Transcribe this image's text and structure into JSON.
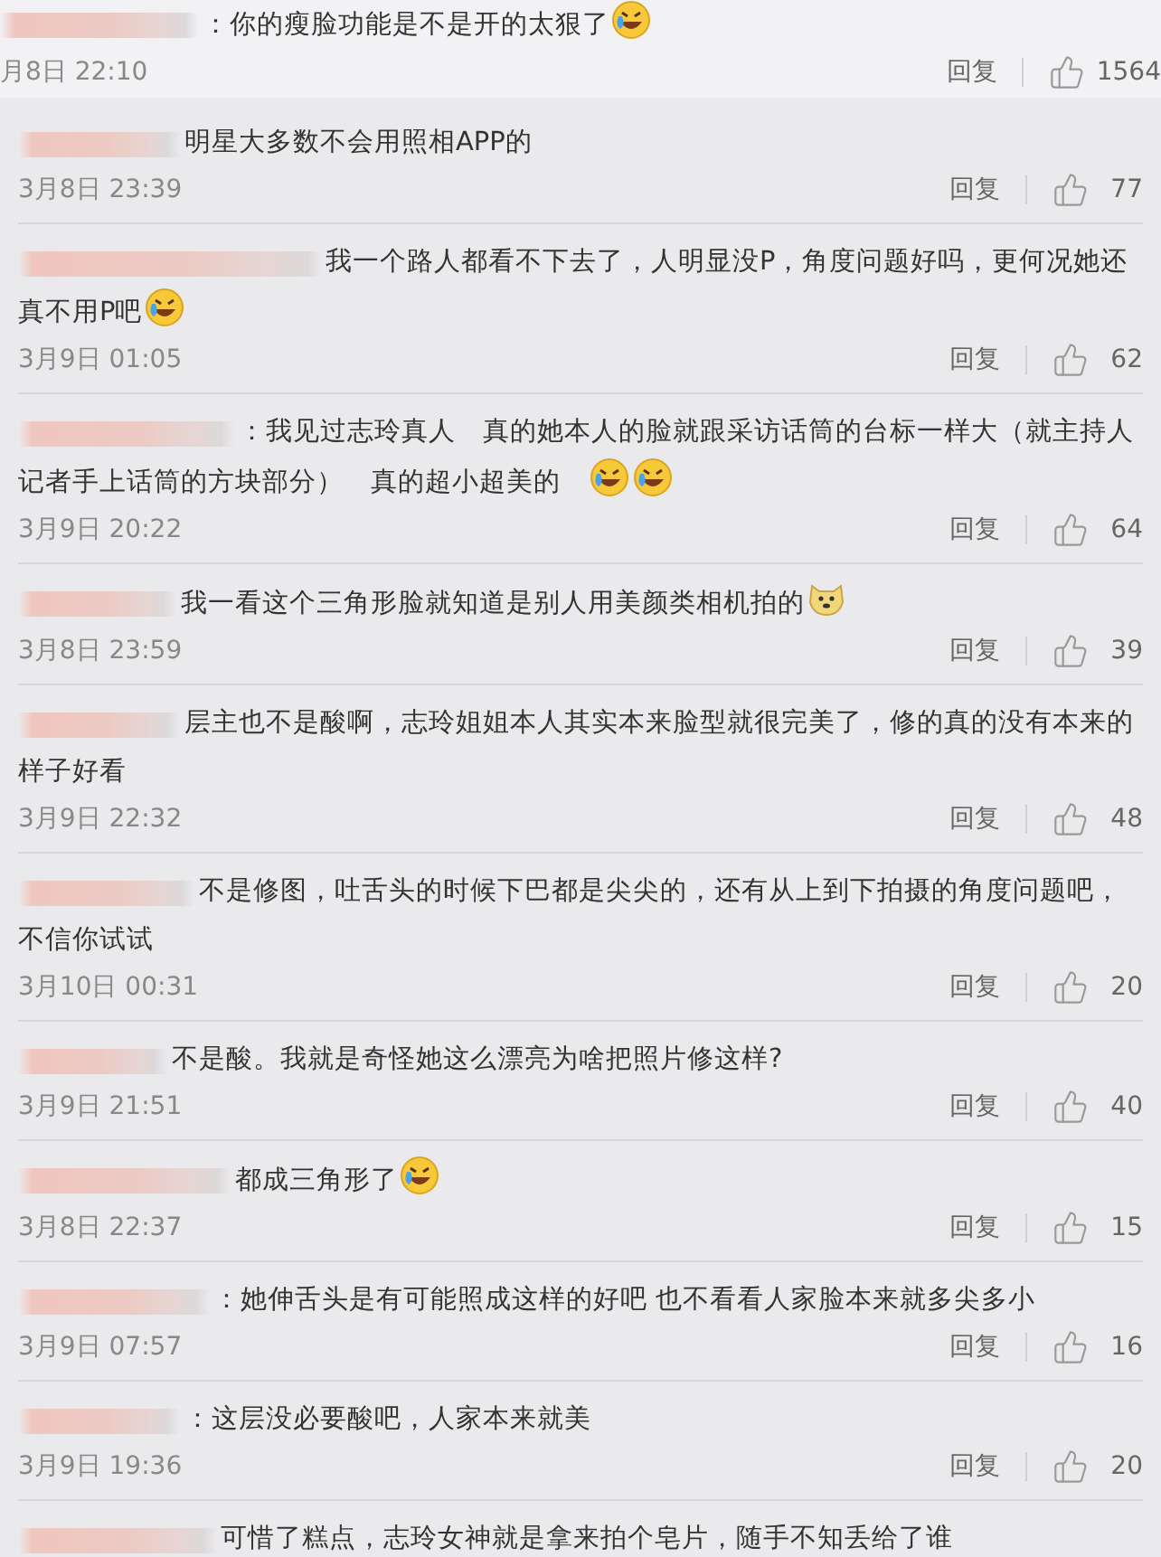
{
  "comments": [
    {
      "kind": "main",
      "text": "：你的瘦脸功能是不是开的太狠了",
      "emojis": [
        {
          "kind": "laugh-cry"
        }
      ],
      "time": "月8日 22:10",
      "reply": "回复",
      "likes": "1564"
    },
    {
      "kind": "sub",
      "text": "明星大多数不会用照相APP的",
      "time": "3月8日 23:39",
      "reply": "回复",
      "likes": "77"
    },
    {
      "kind": "sub",
      "text": "我一个路人都看不下去了，人明显没P，角度问题好吗，更何况她还真不用P吧",
      "emojis": [
        {
          "kind": "laugh-cry"
        }
      ],
      "time": "3月9日 01:05",
      "reply": "回复",
      "likes": "62"
    },
    {
      "kind": "sub",
      "text": "：我见过志玲真人　真的她本人的脸就跟采访话筒的台标一样大（就主持人记者手上话筒的方块部分）　真的超小超美的　",
      "emojis": [
        {
          "kind": "laugh-cry"
        },
        {
          "kind": "laugh-cry"
        }
      ],
      "time": "3月9日 20:22",
      "reply": "回复",
      "likes": "64"
    },
    {
      "kind": "sub",
      "text": "我一看这个三角形脸就知道是别人用美颜类相机拍的",
      "emojis": [
        {
          "kind": "doge"
        }
      ],
      "time": "3月8日 23:59",
      "reply": "回复",
      "likes": "39"
    },
    {
      "kind": "sub",
      "text": "层主也不是酸啊，志玲姐姐本人其实本来脸型就很完美了，修的真的没有本来的样子好看",
      "time": "3月9日 22:32",
      "reply": "回复",
      "likes": "48"
    },
    {
      "kind": "sub",
      "text": "不是修图，吐舌头的时候下巴都是尖尖的，还有从上到下拍摄的角度问题吧，不信你试试",
      "time": "3月10日 00:31",
      "reply": "回复",
      "likes": "20"
    },
    {
      "kind": "sub",
      "text": "不是酸。我就是奇怪她这么漂亮为啥把照片修这样?",
      "time": "3月9日 21:51",
      "reply": "回复",
      "likes": "40"
    },
    {
      "kind": "sub",
      "text": "都成三角形了",
      "emojis": [
        {
          "kind": "laugh-cry"
        }
      ],
      "time": "3月8日 22:37",
      "reply": "回复",
      "likes": "15"
    },
    {
      "kind": "sub",
      "text": "：她伸舌头是有可能照成这样的好吧 也不看看人家脸本来就多尖多小",
      "time": "3月9日 07:57",
      "reply": "回复",
      "likes": "16"
    },
    {
      "kind": "sub",
      "text": "：这层没必要酸吧，人家本来就美",
      "time": "3月9日 19:36",
      "reply": "回复",
      "likes": "20"
    },
    {
      "kind": "sub",
      "text": "可惜了糕点，志玲女神就是拿来拍个皂片，随手不知丢给了谁"
    }
  ]
}
